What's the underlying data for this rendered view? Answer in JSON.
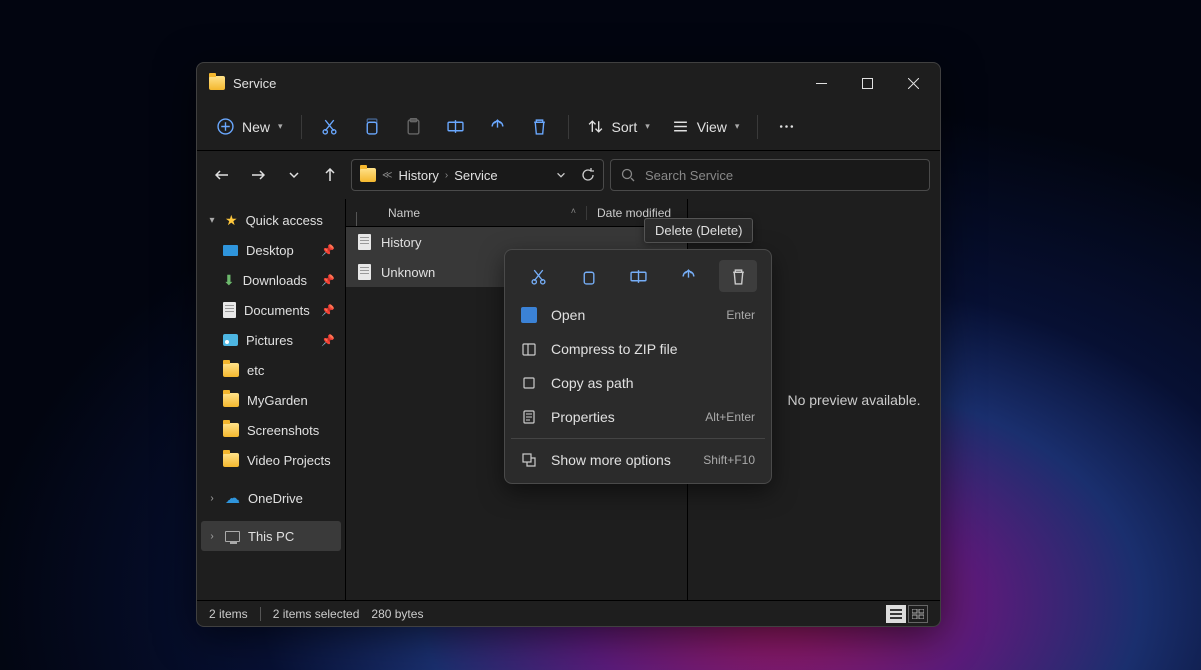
{
  "window": {
    "title": "Service"
  },
  "toolbar": {
    "new": "New",
    "sort": "Sort",
    "view": "View"
  },
  "breadcrumb": {
    "seg1": "History",
    "seg2": "Service"
  },
  "search": {
    "placeholder": "Search Service"
  },
  "sidebar": {
    "quick_access": "Quick access",
    "items": {
      "desktop": "Desktop",
      "downloads": "Downloads",
      "documents": "Documents",
      "pictures": "Pictures",
      "etc": "etc",
      "mygarden": "MyGarden",
      "screenshots": "Screenshots",
      "videoprojects": "Video Projects"
    },
    "onedrive": "OneDrive",
    "thispc": "This PC"
  },
  "columns": {
    "name": "Name",
    "date": "Date modified"
  },
  "files": {
    "history": "History",
    "unknown": "Unknown"
  },
  "preview": {
    "none": "No preview available."
  },
  "status": {
    "items": "2 items",
    "selected": "2 items selected",
    "size": "280 bytes"
  },
  "tooltip": {
    "delete": "Delete (Delete)"
  },
  "context": {
    "open": "Open",
    "open_sc": "Enter",
    "compress": "Compress to ZIP file",
    "copypath": "Copy as path",
    "properties": "Properties",
    "properties_sc": "Alt+Enter",
    "showmore": "Show more options",
    "showmore_sc": "Shift+F10"
  }
}
